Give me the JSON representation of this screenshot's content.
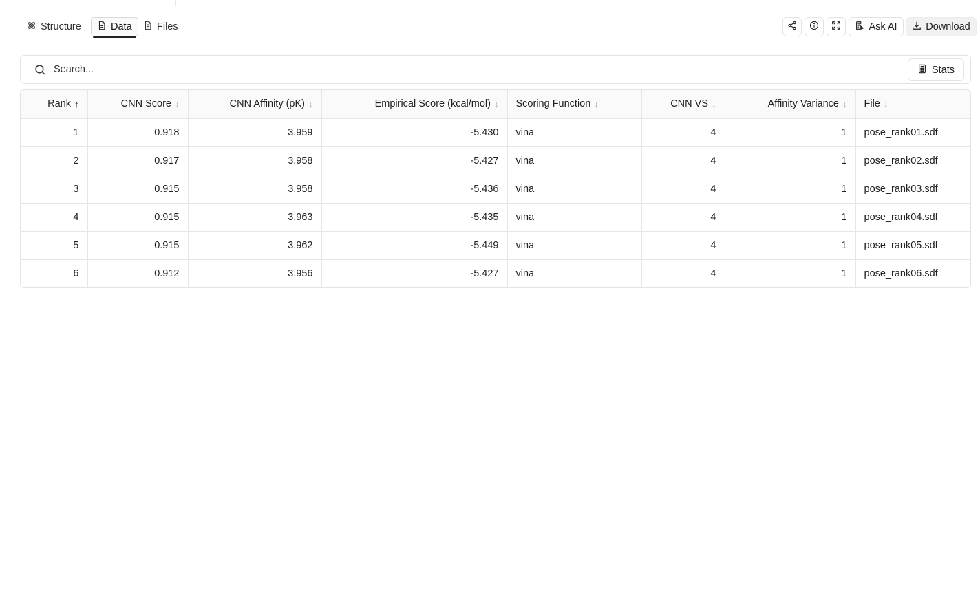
{
  "tabs": [
    {
      "label": "Structure",
      "icon": "atom-icon"
    },
    {
      "label": "Data",
      "icon": "document-icon",
      "active": true
    },
    {
      "label": "Files",
      "icon": "file-text-icon"
    }
  ],
  "toolbar": {
    "share_icon": "share-icon",
    "info_icon": "info-icon",
    "expand_icon": "expand-icon",
    "ask_ai_label": "Ask AI",
    "download_label": "Download"
  },
  "search": {
    "placeholder": "Search...",
    "stats_label": "Stats"
  },
  "table": {
    "columns": [
      {
        "label": "Rank",
        "sort": "↑",
        "align": "r"
      },
      {
        "label": "CNN Score",
        "sort": "↓",
        "align": "r"
      },
      {
        "label": "CNN Affinity (pK)",
        "sort": "↓",
        "align": "r"
      },
      {
        "label": "Empirical Score (kcal/mol)",
        "sort": "↓",
        "align": "r"
      },
      {
        "label": "Scoring Function",
        "sort": "↓",
        "align": "l"
      },
      {
        "label": "CNN VS",
        "sort": "↓",
        "align": "r"
      },
      {
        "label": "Affinity Variance",
        "sort": "↓",
        "align": "r"
      },
      {
        "label": "File",
        "sort": "↓",
        "align": "l"
      }
    ],
    "rows": [
      [
        "1",
        "0.918",
        "3.959",
        "-5.430",
        "vina",
        "4",
        "1",
        "pose_rank01.sdf"
      ],
      [
        "2",
        "0.917",
        "3.958",
        "-5.427",
        "vina",
        "4",
        "1",
        "pose_rank02.sdf"
      ],
      [
        "3",
        "0.915",
        "3.958",
        "-5.436",
        "vina",
        "4",
        "1",
        "pose_rank03.sdf"
      ],
      [
        "4",
        "0.915",
        "3.963",
        "-5.435",
        "vina",
        "4",
        "1",
        "pose_rank04.sdf"
      ],
      [
        "5",
        "0.915",
        "3.962",
        "-5.449",
        "vina",
        "4",
        "1",
        "pose_rank05.sdf"
      ],
      [
        "6",
        "0.912",
        "3.956",
        "-5.427",
        "vina",
        "4",
        "1",
        "pose_rank06.sdf"
      ]
    ]
  }
}
